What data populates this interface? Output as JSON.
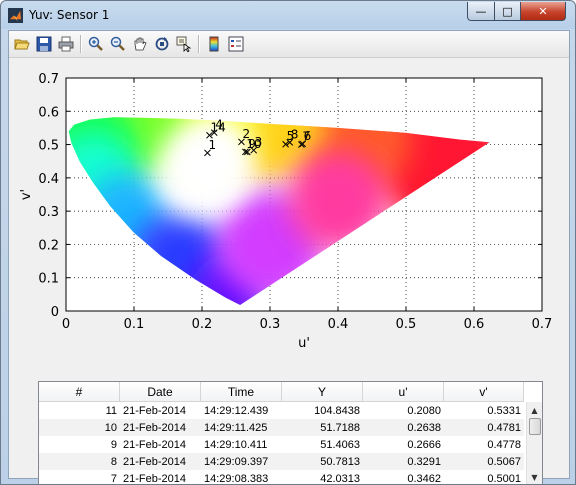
{
  "window": {
    "title": "Yuv: Sensor 1",
    "minimize_glyph": "—",
    "maximize_glyph": "□",
    "close_glyph": "✕"
  },
  "toolbar": {
    "buttons": [
      "open-icon",
      "save-icon",
      "print-icon",
      "zoom-in-icon",
      "zoom-out-icon",
      "pan-icon",
      "rotate-icon",
      "data-cursor-icon",
      "colorbar-icon",
      "legend-icon"
    ]
  },
  "chart_data": {
    "type": "scatter",
    "title": "",
    "xlabel": "u'",
    "ylabel": "v'",
    "xlim": [
      0,
      0.7
    ],
    "ylim": [
      0,
      0.7
    ],
    "xticks": [
      "0",
      "0.1",
      "0.2",
      "0.3",
      "0.4",
      "0.5",
      "0.6",
      "0.7"
    ],
    "yticks": [
      "0",
      "0.1",
      "0.2",
      "0.3",
      "0.4",
      "0.5",
      "0.6",
      "0.7"
    ],
    "grid": true,
    "background": "CIE 1976 u'v' chromaticity diagram",
    "points": [
      {
        "label": "1",
        "u": 0.208,
        "v": 0.475
      },
      {
        "label": "14",
        "u": 0.211,
        "v": 0.528
      },
      {
        "label": "4",
        "u": 0.218,
        "v": 0.536
      },
      {
        "label": "2",
        "u": 0.258,
        "v": 0.508
      },
      {
        "label": "9",
        "u": 0.2666,
        "v": 0.4778
      },
      {
        "label": "10",
        "u": 0.2638,
        "v": 0.4781
      },
      {
        "label": "3",
        "u": 0.276,
        "v": 0.483
      },
      {
        "label": "5",
        "u": 0.323,
        "v": 0.501
      },
      {
        "label": "8",
        "u": 0.3291,
        "v": 0.5067
      },
      {
        "label": "6",
        "u": 0.348,
        "v": 0.502
      },
      {
        "label": "7",
        "u": 0.3462,
        "v": 0.5001
      }
    ]
  },
  "table": {
    "columns": [
      "#",
      "Date",
      "Time",
      "Y",
      "u'",
      "v'"
    ],
    "rows": [
      [
        "11",
        "21-Feb-2014",
        "14:29:12.439",
        "104.8438",
        "0.2080",
        "0.5331"
      ],
      [
        "10",
        "21-Feb-2014",
        "14:29:11.425",
        "51.7188",
        "0.2638",
        "0.4781"
      ],
      [
        "9",
        "21-Feb-2014",
        "14:29:10.411",
        "51.4063",
        "0.2666",
        "0.4778"
      ],
      [
        "8",
        "21-Feb-2014",
        "14:29:09.397",
        "50.7813",
        "0.3291",
        "0.5067"
      ],
      [
        "7",
        "21-Feb-2014",
        "14:29:08.383",
        "42.0313",
        "0.3462",
        "0.5001"
      ]
    ],
    "scroll_up_glyph": "▲",
    "scroll_down_glyph": "▼"
  }
}
